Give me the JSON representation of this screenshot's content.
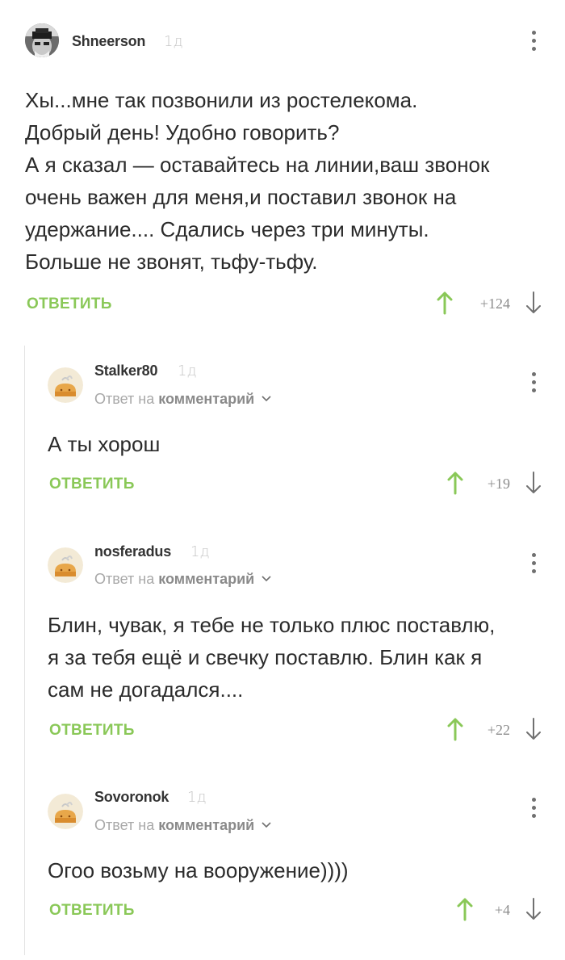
{
  "comments": [
    {
      "username": "Shneerson",
      "time": "1д",
      "reply_to": null,
      "text_lines": [
        "Хы...мне так позвонили из ростелекома.",
        "Добрый день! Удобно говорить?",
        "А я сказал — оставайтесь на линии,ваш звонок",
        "очень важен для меня,и поставил звонок на",
        "удержание.... Сдались через три минуты.",
        "Больше не звонят, тьфу-тьфу."
      ],
      "reply_label": "ОТВЕТИТЬ",
      "score": "+124"
    },
    {
      "username": "Stalker80",
      "time": "1д",
      "reply_to": {
        "prefix": "Ответ на",
        "target": "комментарий"
      },
      "text_lines": [
        "А ты хорош"
      ],
      "reply_label": "ОТВЕТИТЬ",
      "score": "+19"
    },
    {
      "username": "nosferadus",
      "time": "1д",
      "reply_to": {
        "prefix": "Ответ на",
        "target": "комментарий"
      },
      "text_lines": [
        "Блин, чувак, я тебе не только плюс поставлю,",
        "я за тебя ещё и свечку поставлю. Блин как я",
        "сам не догадался...."
      ],
      "reply_label": "ОТВЕТИТЬ",
      "score": "+22"
    },
    {
      "username": "Sovoronok",
      "time": "1д",
      "reply_to": {
        "prefix": "Ответ на",
        "target": "комментарий"
      },
      "text_lines": [
        "Огоо возьму на вооружение))))"
      ],
      "reply_label": "ОТВЕТИТЬ",
      "score": "+4"
    }
  ],
  "colors": {
    "accent_green": "#8ac858",
    "icon_grey": "#707070",
    "meta_grey": "#a8a8a8"
  },
  "icons": [
    "avatar",
    "menu-dots-icon",
    "vote-up-icon",
    "vote-down-icon",
    "chevron-down-icon"
  ]
}
